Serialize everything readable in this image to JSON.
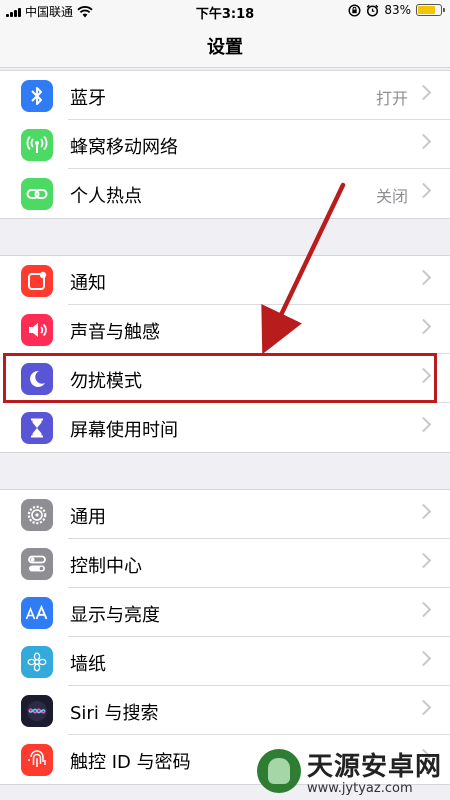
{
  "status_bar": {
    "carrier": "中国联通",
    "time": "下午3:18",
    "battery_text": "83%",
    "battery_level": 0.83
  },
  "nav": {
    "title": "设置"
  },
  "groups": [
    {
      "items": [
        {
          "label": "蓝牙",
          "value": "打开",
          "icon": "bluetooth-icon",
          "color": "#2f7cf6"
        },
        {
          "label": "蜂窝移动网络",
          "value": "",
          "icon": "cellular-icon",
          "color": "#4cd964"
        },
        {
          "label": "个人热点",
          "value": "关闭",
          "icon": "hotspot-icon",
          "color": "#4cd964"
        }
      ]
    },
    {
      "items": [
        {
          "label": "通知",
          "value": "",
          "icon": "notifications-icon",
          "color": "#ff3b30"
        },
        {
          "label": "声音与触感",
          "value": "",
          "icon": "sounds-icon",
          "color": "#ff2d55"
        },
        {
          "label": "勿扰模式",
          "value": "",
          "icon": "moon-icon",
          "color": "#5856d6"
        },
        {
          "label": "屏幕使用时间",
          "value": "",
          "icon": "hourglass-icon",
          "color": "#5856d6"
        }
      ]
    },
    {
      "items": [
        {
          "label": "通用",
          "value": "",
          "icon": "gear-icon",
          "color": "#8e8e93"
        },
        {
          "label": "控制中心",
          "value": "",
          "icon": "control-center-icon",
          "color": "#8e8e93"
        },
        {
          "label": "显示与亮度",
          "value": "",
          "icon": "display-icon",
          "color": "#2f7cf6"
        },
        {
          "label": "墙纸",
          "value": "",
          "icon": "wallpaper-icon",
          "color": "#34aadc"
        },
        {
          "label": "Siri 与搜索",
          "value": "",
          "icon": "siri-icon",
          "color": "#1c1c2e"
        },
        {
          "label": "触控 ID 与密码",
          "value": "",
          "icon": "fingerprint-icon",
          "color": "#ff3b30"
        }
      ]
    }
  ],
  "watermark": {
    "title": "天源安卓网",
    "url": "www.jytyaz.com"
  }
}
